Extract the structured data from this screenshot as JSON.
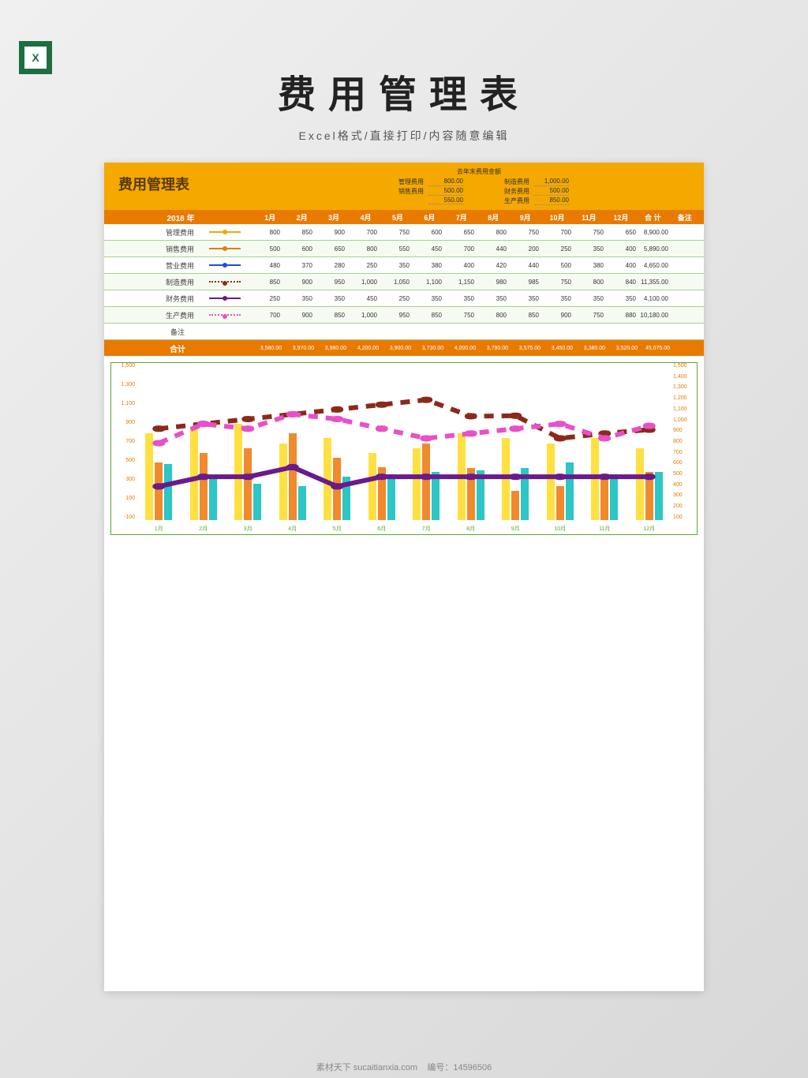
{
  "main_title": "费用管理表",
  "subtitle": "Excel格式/直接打印/内容随意编辑",
  "excel_icon_text": "X",
  "sheet_title": "费用管理表",
  "last_year": {
    "title": "去年末费用金额",
    "left": [
      {
        "label": "管理费用",
        "value": "800.00"
      },
      {
        "label": "销售费用",
        "value": "500.00"
      },
      {
        "label": "",
        "value": "550.00"
      }
    ],
    "right": [
      {
        "label": "制造费用",
        "value": "1,000.00"
      },
      {
        "label": "财务费用",
        "value": "500.00"
      },
      {
        "label": "生产费用",
        "value": "850.00"
      }
    ]
  },
  "year_label": "2018 年",
  "months": [
    "1月",
    "2月",
    "3月",
    "4月",
    "5月",
    "6月",
    "7月",
    "8月",
    "9月",
    "10月",
    "11月",
    "12月",
    "合 计",
    "备注"
  ],
  "rows": [
    {
      "name": "管理费用",
      "color": "#f4a800",
      "vals": [
        "800",
        "850",
        "900",
        "700",
        "750",
        "600",
        "650",
        "800",
        "750",
        "700",
        "750",
        "650",
        "8,900.00",
        ""
      ]
    },
    {
      "name": "销售费用",
      "color": "#e87a00",
      "vals": [
        "500",
        "600",
        "650",
        "800",
        "550",
        "450",
        "700",
        "440",
        "200",
        "250",
        "350",
        "400",
        "5,890.00",
        ""
      ]
    },
    {
      "name": "营业费用",
      "color": "#1a4fd6",
      "vals": [
        "480",
        "370",
        "280",
        "250",
        "350",
        "380",
        "400",
        "420",
        "440",
        "500",
        "380",
        "400",
        "4,650.00",
        ""
      ]
    },
    {
      "name": "制造费用",
      "color": "#8b2a1a",
      "dash": true,
      "vals": [
        "850",
        "900",
        "950",
        "1,000",
        "1,050",
        "1,100",
        "1,150",
        "980",
        "985",
        "750",
        "800",
        "840",
        "11,355.00",
        ""
      ]
    },
    {
      "name": "财务费用",
      "color": "#6a1a8b",
      "vals": [
        "250",
        "350",
        "350",
        "450",
        "250",
        "350",
        "350",
        "350",
        "350",
        "350",
        "350",
        "350",
        "4,100.00",
        ""
      ]
    },
    {
      "name": "生产费用",
      "color": "#e850c8",
      "dash": true,
      "vals": [
        "700",
        "900",
        "850",
        "1,000",
        "950",
        "850",
        "750",
        "800",
        "850",
        "900",
        "750",
        "880",
        "10,180.00",
        ""
      ]
    }
  ],
  "remark_label": "备注",
  "total": {
    "label": "合计",
    "vals": [
      "3,580.00",
      "3,970.00",
      "3,980.00",
      "4,200.00",
      "3,900.00",
      "3,730.00",
      "4,000.00",
      "3,790.00",
      "3,575.00",
      "3,450.00",
      "3,380.00",
      "3,520.00",
      "45,075.00",
      ""
    ]
  },
  "chart_data": {
    "type": "bar",
    "categories": [
      "1月",
      "2月",
      "3月",
      "4月",
      "5月",
      "6月",
      "7月",
      "8月",
      "9月",
      "10月",
      "11月",
      "12月"
    ],
    "y_left_ticks": [
      "1,500",
      "1,300",
      "1,100",
      "900",
      "700",
      "500",
      "300",
      "100",
      "-100"
    ],
    "y_right_ticks": [
      "1,500",
      "1,400",
      "1,300",
      "1,200",
      "1,100",
      "1,000",
      "900",
      "800",
      "700",
      "600",
      "500",
      "400",
      "300",
      "200",
      "100"
    ],
    "ylim": [
      -100,
      1500
    ],
    "series": [
      {
        "name": "管理费用",
        "type": "bar",
        "color": "#ffe040",
        "values": [
          800,
          850,
          900,
          700,
          750,
          600,
          650,
          800,
          750,
          700,
          750,
          650
        ]
      },
      {
        "name": "销售费用",
        "type": "bar",
        "color": "#f08a2c",
        "values": [
          500,
          600,
          650,
          800,
          550,
          450,
          700,
          440,
          200,
          250,
          350,
          400
        ]
      },
      {
        "name": "营业费用",
        "type": "bar",
        "color": "#2cc6c6",
        "values": [
          480,
          370,
          280,
          250,
          350,
          380,
          400,
          420,
          440,
          500,
          380,
          400
        ]
      },
      {
        "name": "制造费用",
        "type": "line",
        "color": "#8b2a1a",
        "dash": true,
        "values": [
          850,
          900,
          950,
          1000,
          1050,
          1100,
          1150,
          980,
          985,
          750,
          800,
          840
        ]
      },
      {
        "name": "财务费用",
        "type": "line",
        "color": "#6a1a8b",
        "values": [
          250,
          350,
          350,
          450,
          250,
          350,
          350,
          350,
          350,
          350,
          350,
          350
        ]
      },
      {
        "name": "生产费用",
        "type": "line",
        "color": "#e850c8",
        "dash": true,
        "values": [
          700,
          900,
          850,
          1000,
          950,
          850,
          750,
          800,
          850,
          900,
          750,
          880
        ]
      }
    ]
  },
  "footer": {
    "site": "素材天下 sucaitianxia.com",
    "id_label": "编号：",
    "id": "14596506"
  }
}
